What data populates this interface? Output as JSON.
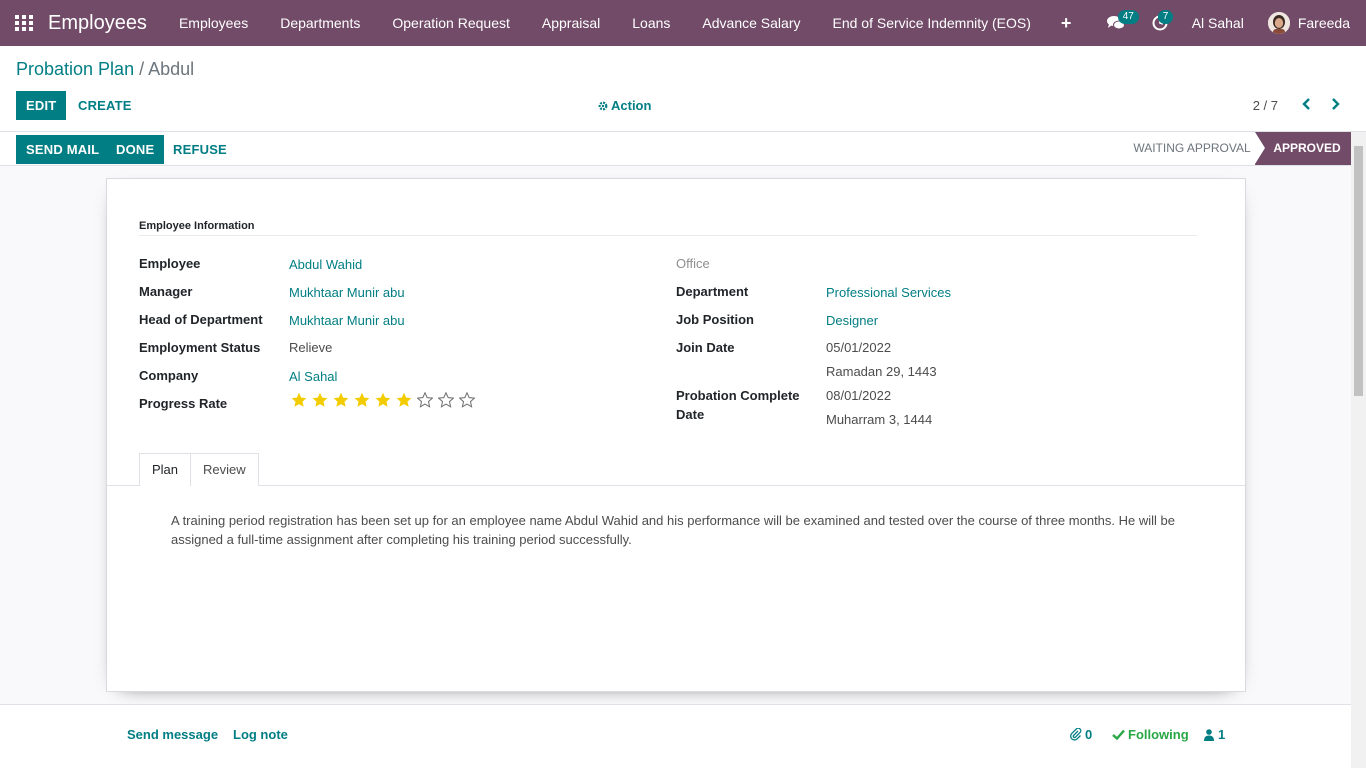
{
  "navbar": {
    "app_title": "Employees",
    "menu": [
      "Employees",
      "Departments",
      "Operation Request",
      "Appraisal",
      "Loans",
      "Advance Salary",
      "End of Service Indemnity (EOS)"
    ],
    "plus": "+",
    "messages_count": "47",
    "activities_count": "7",
    "company": "Al Sahal",
    "user": "Fareeda"
  },
  "breadcrumb": {
    "parent": "Probation Plan",
    "separator": "/",
    "current": "Abdul"
  },
  "toolbar": {
    "edit": "EDIT",
    "create": "CREATE",
    "action": "Action",
    "pager": "2 / 7"
  },
  "statusbar": {
    "send_mail": "SEND MAIL",
    "done": "DONE",
    "refuse": "REFUSE",
    "stages": [
      "WAITING APPROVAL",
      "APPROVED"
    ],
    "active_stage": "APPROVED"
  },
  "form": {
    "group_title": "Employee Information",
    "left": {
      "employee_label": "Employee",
      "employee": "Abdul Wahid",
      "manager_label": "Manager",
      "manager": "Mukhtaar Munir abu",
      "hod_label": "Head of Department",
      "hod": "Mukhtaar Munir abu",
      "status_label": "Employment Status",
      "status": "Relieve",
      "company_label": "Company",
      "company": "Al Sahal",
      "progress_label": "Progress Rate"
    },
    "progress_rate": {
      "value": 6,
      "max": 9
    },
    "right": {
      "office": "Office",
      "department_label": "Department",
      "department": "Professional Services",
      "job_label": "Job Position",
      "job": "Designer",
      "join_label": "Join Date",
      "join_date": "05/01/2022",
      "join_hijri": "Ramadan 29, 1443",
      "probation_label_1": "Probation Complete",
      "probation_label_2": "Date",
      "probation_date": "08/01/2022",
      "probation_hijri": "Muharram 3, 1444"
    },
    "tabs": [
      "Plan",
      "Review"
    ],
    "active_tab": "Plan",
    "plan_text": "A training period registration has been set up for an employee name Abdul Wahid and his performance will be examined and tested over the course of three months. He will be assigned a full-time assignment after completing his training period successfully."
  },
  "chatter": {
    "send_message": "Send message",
    "log_note": "Log note",
    "attachments": "0",
    "following": "Following",
    "followers": "1"
  },
  "colors": {
    "brand": "#714b67",
    "accent": "#017e84",
    "star": "#f3cc00",
    "following": "#28a745"
  }
}
